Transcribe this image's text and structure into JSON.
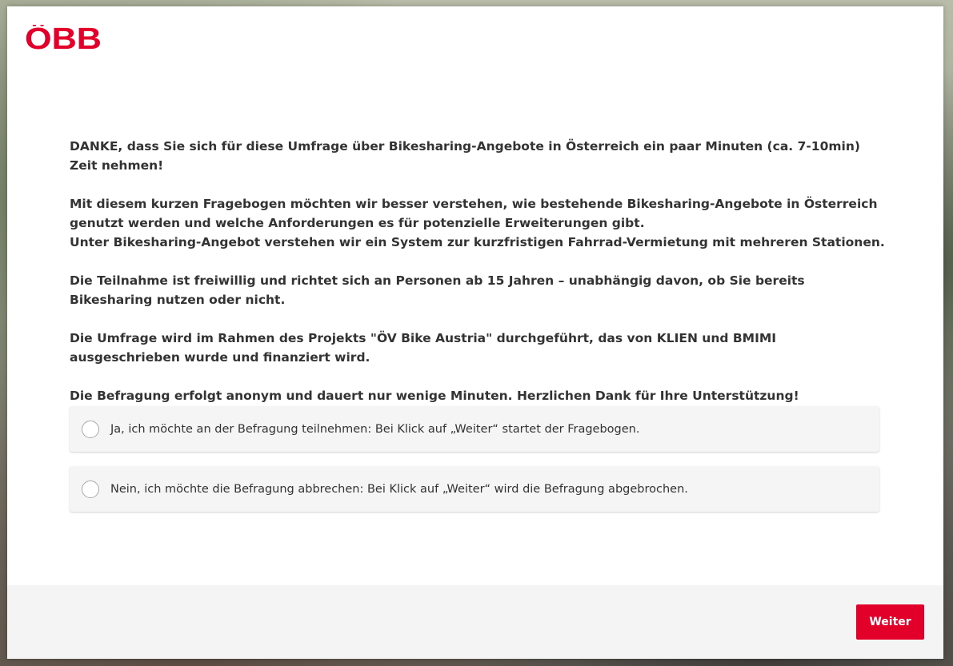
{
  "brand": {
    "logo_text": "ÖBB",
    "logo_color": "#e2002a"
  },
  "intro": {
    "paragraphs": [
      "DANKE, dass Sie sich für diese Umfrage über Bikesharing-Angebote in Österreich ein paar Minuten (ca. 7-10min) Zeit nehmen!",
      "Mit diesem kurzen Fragebogen möchten wir besser verstehen, wie bestehende Bikesharing-Angebote in Österreich genutzt werden und welche Anforderungen es für potenzielle Erweiterungen gibt.",
      "Unter Bikesharing-Angebot verstehen wir ein System zur kurzfristigen Fahrrad-Vermietung mit mehreren Stationen.",
      "Die Teilnahme ist freiwillig und richtet sich an Personen ab 15 Jahren – unabhängig davon, ob Sie bereits Bikesharing nutzen oder nicht.",
      "Die Umfrage wird im Rahmen des Projekts \"ÖV Bike Austria\" durchgeführt, das von KLIEN und BMIMI ausgeschrieben wurde und finanziert wird.",
      "Die Befragung erfolgt anonym und dauert nur wenige Minuten. Herzlichen Dank für Ihre Unterstützung!"
    ]
  },
  "options": [
    {
      "label": "Ja, ich möchte an der Befragung teilnehmen: Bei Klick auf „Weiter“ startet der Fragebogen.",
      "selected": false
    },
    {
      "label": "Nein, ich möchte die Befragung abbrechen: Bei Klick auf „Weiter“ wird die Befragung abgebrochen.",
      "selected": false
    }
  ],
  "footer": {
    "next_label": "Weiter",
    "accent_color": "#e2002a"
  }
}
